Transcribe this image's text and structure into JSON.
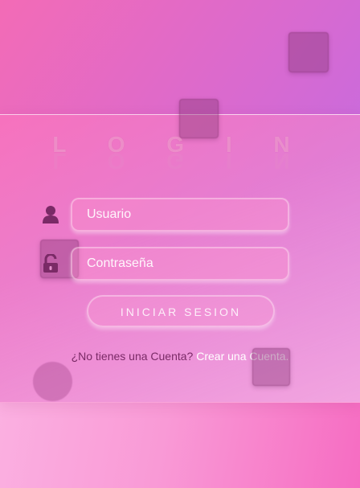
{
  "page": {
    "title": "L O G I N"
  },
  "form": {
    "username_placeholder": "Usuario",
    "password_placeholder": "Contraseña",
    "submit_label": "INICIAR SESION"
  },
  "signup": {
    "prompt": "¿No tienes una Cuenta?",
    "link": "Crear una Cuenta."
  },
  "icons": {
    "user": "user-icon",
    "lock": "unlock-icon"
  },
  "colors": {
    "accent_pink": "#f36bb6",
    "accent_purple": "#b26cf0",
    "icon_dark": "#7a2a66"
  }
}
